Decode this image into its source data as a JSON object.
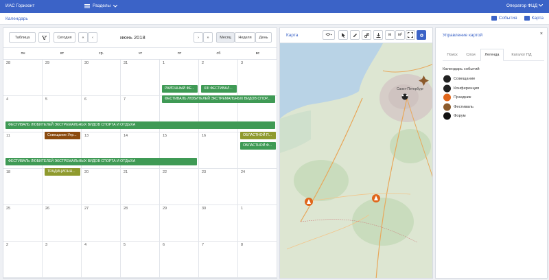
{
  "app": {
    "title": "ИАС Горизонт",
    "menu_label": "Разделы",
    "user_label": "Оператор ФЦД"
  },
  "subbar": {
    "breadcrumb": "Календарь",
    "events_link": "События",
    "map_link": "Карта"
  },
  "calendar": {
    "view_table": "Таблица",
    "today": "Сегодня",
    "prev": "‹",
    "prev2": "«",
    "next": "›",
    "next2": "»",
    "month": "Месяц",
    "week": "Неделя",
    "day": "День",
    "title": "июнь 2018",
    "weekdays": [
      "пн",
      "вт",
      "ср.",
      "чт",
      "пт",
      "сб",
      "вс"
    ],
    "weeks": [
      [
        "28",
        "29",
        "30",
        "31",
        "1",
        "2",
        "3"
      ],
      [
        "4",
        "5",
        "6",
        "7",
        "8",
        "9",
        "10"
      ],
      [
        "11",
        "12",
        "13",
        "14",
        "15",
        "16",
        "17"
      ],
      [
        "18",
        "19",
        "20",
        "21",
        "22",
        "23",
        "24"
      ],
      [
        "25",
        "26",
        "27",
        "28",
        "29",
        "30",
        "1"
      ],
      [
        "2",
        "3",
        "4",
        "5",
        "6",
        "7",
        "8"
      ]
    ],
    "events": {
      "e1": "РАЙОННЫЙ ФЕ...",
      "e2": "XIII ФЕСТИВАЛ...",
      "e3": "ФЕСТИВАЛЬ ЛЮБИТЕЛЕЙ ЭКСТРЕМАЛЬНЫХ ВИДОВ СПОР...",
      "e4": "ФЕСТИВАЛЬ ЛЮБИТЕЛЕЙ ЭКСТРЕМАЛЬНЫХ ВИДОВ СПОРТА И ОТДЫХА",
      "e5": "Совещание Упр...",
      "e6": "ОБЛАСТНОЙ П...",
      "e7": "ОБЛАСТНОЙ Ф...",
      "e8": "ФЕСТИВАЛЬ ЛЮБИТЕЛЕЙ ЭКСТРЕМАЛЬНЫХ ВИДОВ СПОРТА И ОТДЫХА",
      "e9": "ТРАДИЦИОНН..."
    }
  },
  "map": {
    "title": "Карта",
    "tools": [
      "layers",
      "select",
      "draw",
      "link",
      "download",
      "м",
      "м²",
      "fullscreen",
      "settings"
    ],
    "city_label": "Санкт-Петербург"
  },
  "panel": {
    "title": "Управление картой",
    "close": "×",
    "tabs": [
      "Поиск",
      "Слои",
      "Легенда",
      "Каталог ПД"
    ],
    "legend_title": "Календарь событий",
    "legend": [
      {
        "label": "Совещание",
        "color": "#222222"
      },
      {
        "label": "Конференция",
        "color": "#222222"
      },
      {
        "label": "Праздник",
        "color": "#e0661b"
      },
      {
        "label": "Фестиваль",
        "color": "#8b5a2b"
      },
      {
        "label": "Форум",
        "color": "#111111"
      }
    ]
  }
}
